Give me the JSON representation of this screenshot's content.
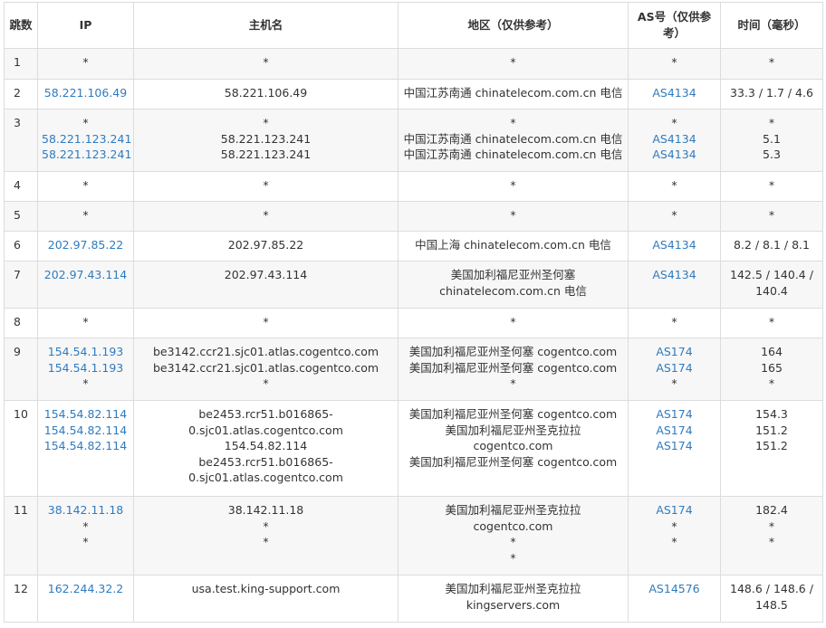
{
  "headers": {
    "hop": "跳数",
    "ip": "IP",
    "hostname": "主机名",
    "region": "地区（仅供参考）",
    "as": "AS号（仅供参考）",
    "time": "时间（毫秒）"
  },
  "rows": [
    {
      "hop": "1",
      "ip": [
        "*"
      ],
      "hostname": [
        "*"
      ],
      "region": [
        "*"
      ],
      "as": [
        "*"
      ],
      "time": [
        "*"
      ]
    },
    {
      "hop": "2",
      "ip": [
        "58.221.106.49"
      ],
      "hostname": [
        "58.221.106.49"
      ],
      "region": [
        "中国江苏南通 chinatelecom.com.cn 电信"
      ],
      "as": [
        "AS4134"
      ],
      "time": [
        "33.3 / 1.7 / 4.6"
      ]
    },
    {
      "hop": "3",
      "ip": [
        "*",
        "58.221.123.241",
        "58.221.123.241"
      ],
      "hostname": [
        "*",
        "58.221.123.241",
        "58.221.123.241"
      ],
      "region": [
        "*",
        "中国江苏南通 chinatelecom.com.cn 电信",
        "中国江苏南通 chinatelecom.com.cn 电信"
      ],
      "as": [
        "*",
        "AS4134",
        "AS4134"
      ],
      "time": [
        "*",
        "5.1",
        "5.3"
      ]
    },
    {
      "hop": "4",
      "ip": [
        "*"
      ],
      "hostname": [
        "*"
      ],
      "region": [
        "*"
      ],
      "as": [
        "*"
      ],
      "time": [
        "*"
      ]
    },
    {
      "hop": "5",
      "ip": [
        "*"
      ],
      "hostname": [
        "*"
      ],
      "region": [
        "*"
      ],
      "as": [
        "*"
      ],
      "time": [
        "*"
      ]
    },
    {
      "hop": "6",
      "ip": [
        "202.97.85.22"
      ],
      "hostname": [
        "202.97.85.22"
      ],
      "region": [
        "中国上海 chinatelecom.com.cn 电信"
      ],
      "as": [
        "AS4134"
      ],
      "time": [
        "8.2 / 8.1 / 8.1"
      ]
    },
    {
      "hop": "7",
      "ip": [
        "202.97.43.114"
      ],
      "hostname": [
        "202.97.43.114"
      ],
      "region": [
        "美国加利福尼亚州圣何塞",
        "chinatelecom.com.cn 电信"
      ],
      "as": [
        "AS4134"
      ],
      "time": [
        "142.5 / 140.4 /",
        "140.4"
      ]
    },
    {
      "hop": "8",
      "ip": [
        "*"
      ],
      "hostname": [
        "*"
      ],
      "region": [
        "*"
      ],
      "as": [
        "*"
      ],
      "time": [
        "*"
      ]
    },
    {
      "hop": "9",
      "ip": [
        "154.54.1.193",
        "154.54.1.193",
        "*"
      ],
      "hostname": [
        "be3142.ccr21.sjc01.atlas.cogentco.com",
        "be3142.ccr21.sjc01.atlas.cogentco.com",
        "*"
      ],
      "region": [
        "美国加利福尼亚州圣何塞 cogentco.com",
        "美国加利福尼亚州圣何塞 cogentco.com",
        "*"
      ],
      "as": [
        "AS174",
        "AS174",
        "*"
      ],
      "time": [
        "164",
        "165",
        "*"
      ]
    },
    {
      "hop": "10",
      "ip": [
        "154.54.82.114",
        "154.54.82.114",
        "154.54.82.114"
      ],
      "hostname": [
        "be2453.rcr51.b016865-",
        "0.sjc01.atlas.cogentco.com",
        "154.54.82.114",
        "be2453.rcr51.b016865-",
        "0.sjc01.atlas.cogentco.com"
      ],
      "region": [
        "美国加利福尼亚州圣何塞 cogentco.com",
        "美国加利福尼亚州圣克拉拉",
        "cogentco.com",
        "美国加利福尼亚州圣何塞 cogentco.com"
      ],
      "as": [
        "AS174",
        "AS174",
        "AS174"
      ],
      "time": [
        "154.3",
        "151.2",
        "151.2"
      ]
    },
    {
      "hop": "11",
      "ip": [
        "38.142.11.18",
        "*",
        "*"
      ],
      "hostname": [
        "38.142.11.18",
        "*",
        "*"
      ],
      "region": [
        "美国加利福尼亚州圣克拉拉",
        "cogentco.com",
        "*",
        "*"
      ],
      "as": [
        "AS174",
        "*",
        "*"
      ],
      "time": [
        "182.4",
        "*",
        "*"
      ]
    },
    {
      "hop": "12",
      "ip": [
        "162.244.32.2"
      ],
      "hostname": [
        "usa.test.king-support.com"
      ],
      "region": [
        "美国加利福尼亚州圣克拉拉",
        "kingservers.com"
      ],
      "as": [
        "AS14576"
      ],
      "time": [
        "148.6 / 148.6 /",
        "148.5"
      ]
    }
  ]
}
